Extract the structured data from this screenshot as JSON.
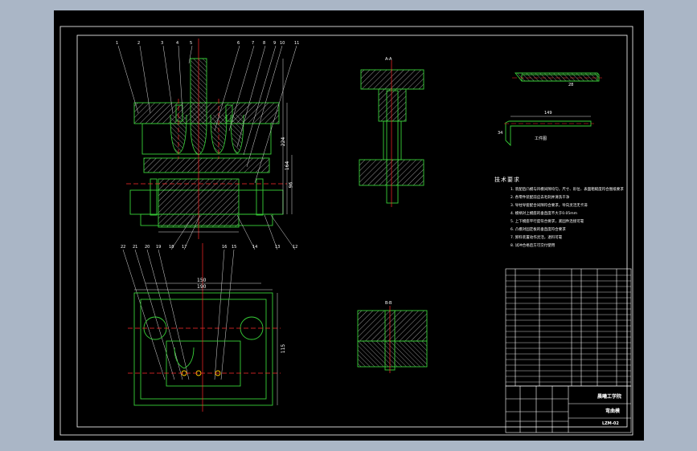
{
  "technical_requirements": {
    "heading": "技术要求",
    "items": [
      "1. 装配后凸模与凹模间隙均匀，尺寸、形位、表面粗糙度符合图纸要求",
      "2. 各零件装配前应去毛刺并清洗干净",
      "3. 导柱导套配合间隙符合要求，导向灵活无卡滞",
      "4. 模柄对上模座的垂直度不大于0.05mm",
      "5. 上下模座平行度符合要求，紧固件连接可靠",
      "6. 凸模对固定板的垂直度符合要求",
      "7. 卸料装置动作灵活，退料可靠",
      "8. 试冲合格后方可交付使用"
    ]
  },
  "title_block": {
    "school": "晨曦工学院",
    "drawing_name": "弯曲模",
    "drawing_number": "LZM-02"
  },
  "dimensions": {
    "total_height": "224",
    "inner_height": "164",
    "mid_height": "96",
    "width_190": "190",
    "width_150": "150",
    "length_115": "115",
    "part_length": "149",
    "part_height": "34",
    "part_width": "28"
  },
  "view_labels": {
    "a": "A-A",
    "b": "B-B",
    "part_label": "工件图"
  },
  "balloons": {
    "top": [
      "1",
      "2",
      "3",
      "4",
      "5",
      "6",
      "7",
      "8",
      "9",
      "10",
      "11"
    ],
    "bottom": [
      "22",
      "21",
      "20",
      "19",
      "18",
      "17",
      "16",
      "15",
      "14",
      "13",
      "12"
    ]
  },
  "colors": {
    "background": "#000000",
    "frame": "#ffffff",
    "outline": "#38d038",
    "centerline": "#ff2a2a",
    "hatch": "#ffffff",
    "window_bg": "#aab6c6"
  }
}
